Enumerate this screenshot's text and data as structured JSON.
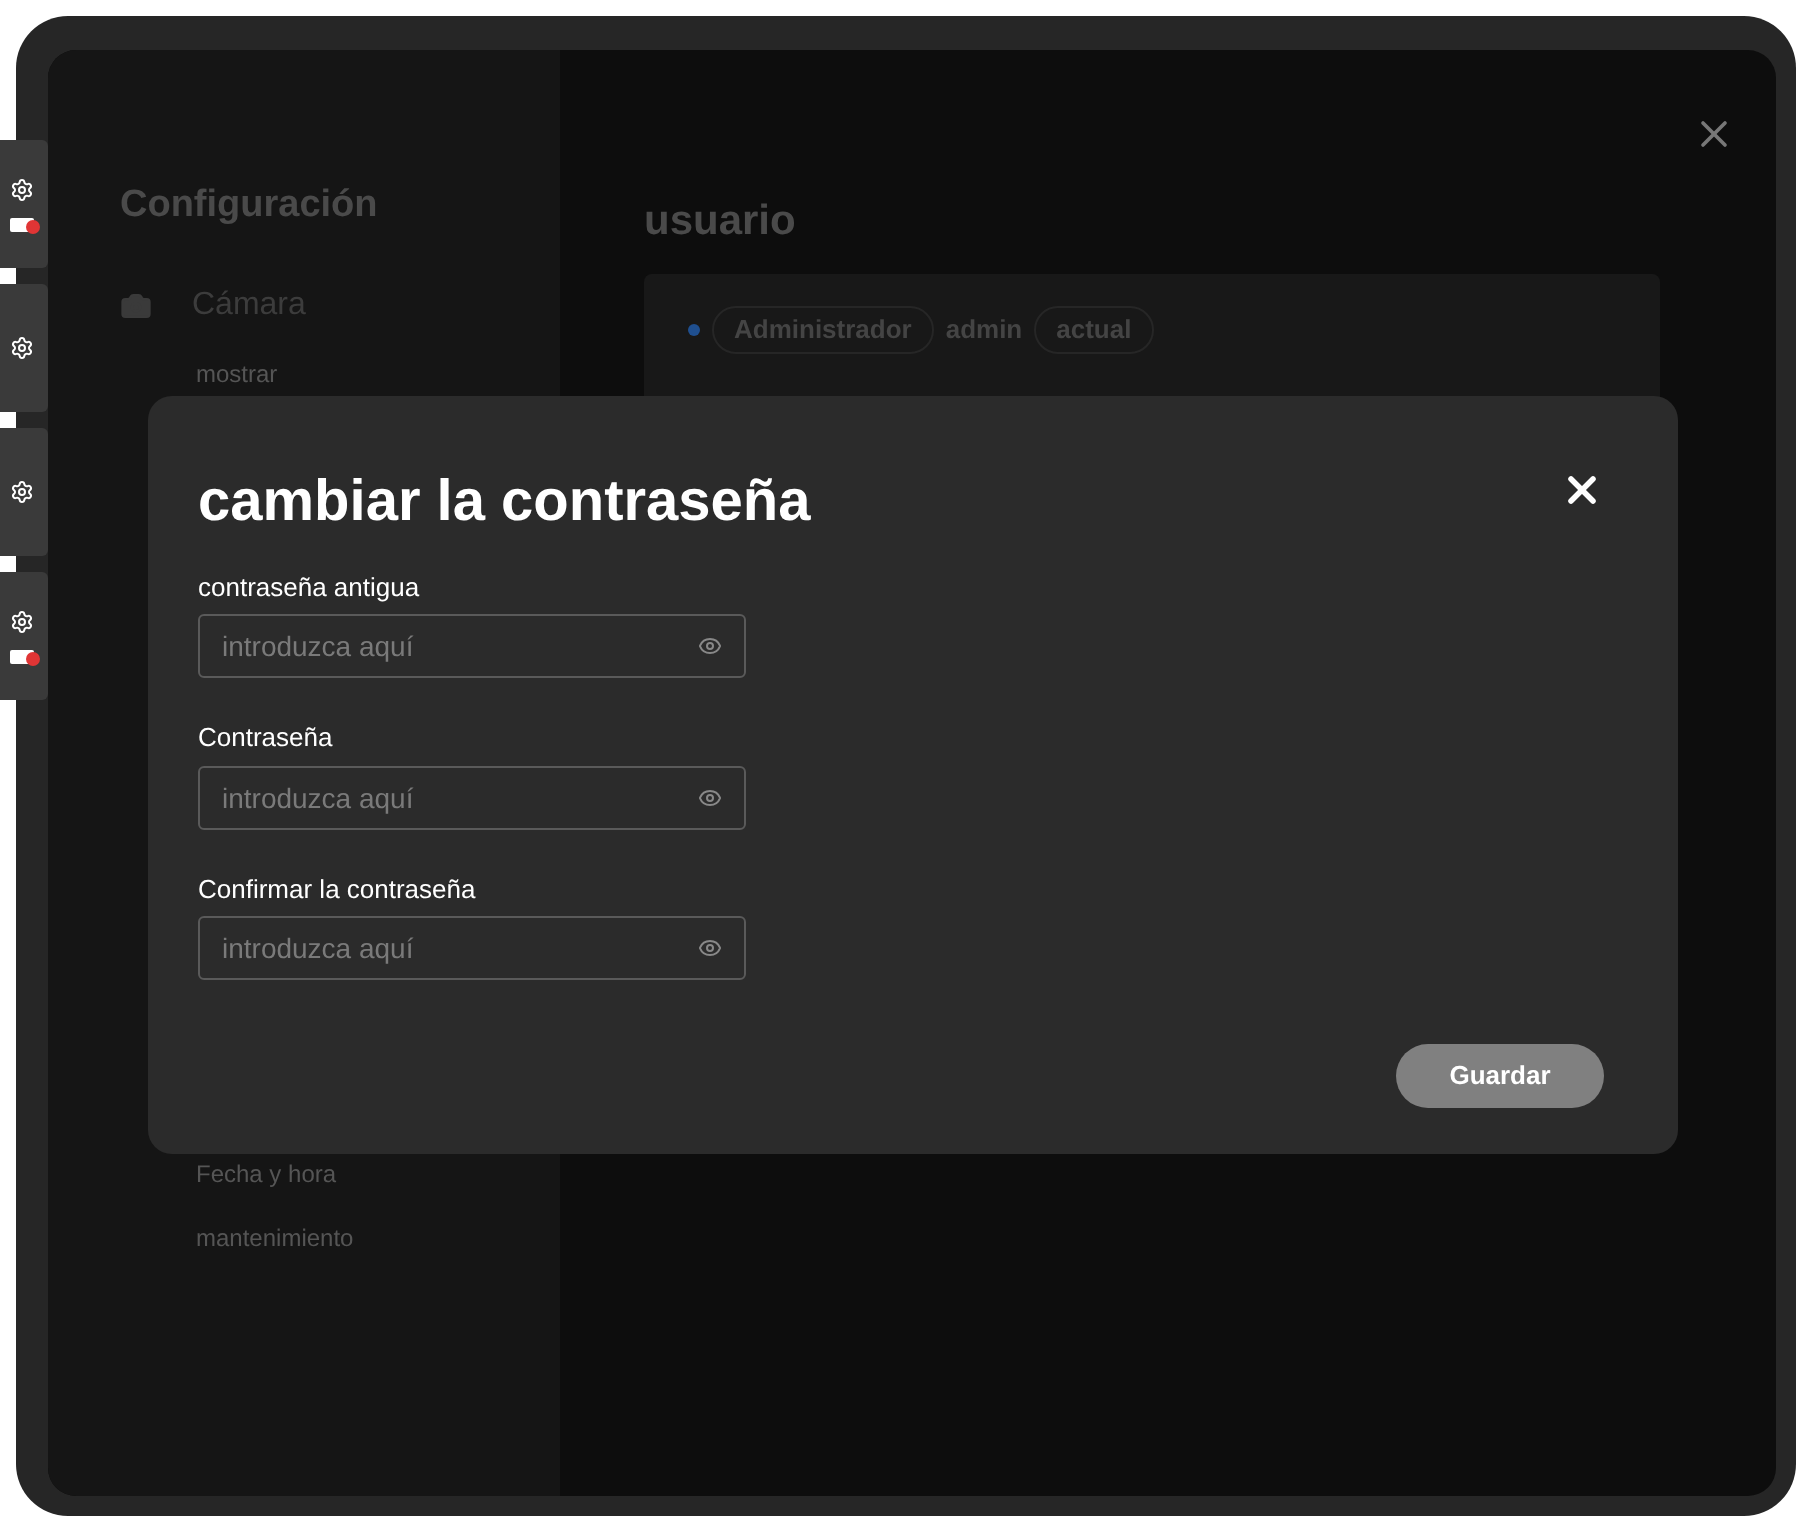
{
  "side_strip": [
    {
      "alert": true
    },
    {
      "alert": false
    },
    {
      "alert": false
    },
    {
      "alert": true
    }
  ],
  "sidebar": {
    "title": "Configuración",
    "items": [
      {
        "kind": "group",
        "label": "Cámara"
      },
      {
        "kind": "item",
        "label": "mostrar"
      },
      {
        "kind": "item",
        "label": "Fecha y hora"
      },
      {
        "kind": "item",
        "label": "mantenimiento"
      }
    ]
  },
  "main": {
    "title": "usuario",
    "user": {
      "role": "Administrador",
      "name": "admin",
      "status": "actual"
    }
  },
  "dialog": {
    "title": "cambiar la contraseña",
    "fields": [
      {
        "label": "contraseña antigua",
        "placeholder": "introduzca aquí"
      },
      {
        "label": "Contraseña",
        "placeholder": "introduzca aquí"
      },
      {
        "label": "Confirmar la contraseña",
        "placeholder": "introduzca aquí"
      }
    ],
    "save_button": "Guardar"
  }
}
